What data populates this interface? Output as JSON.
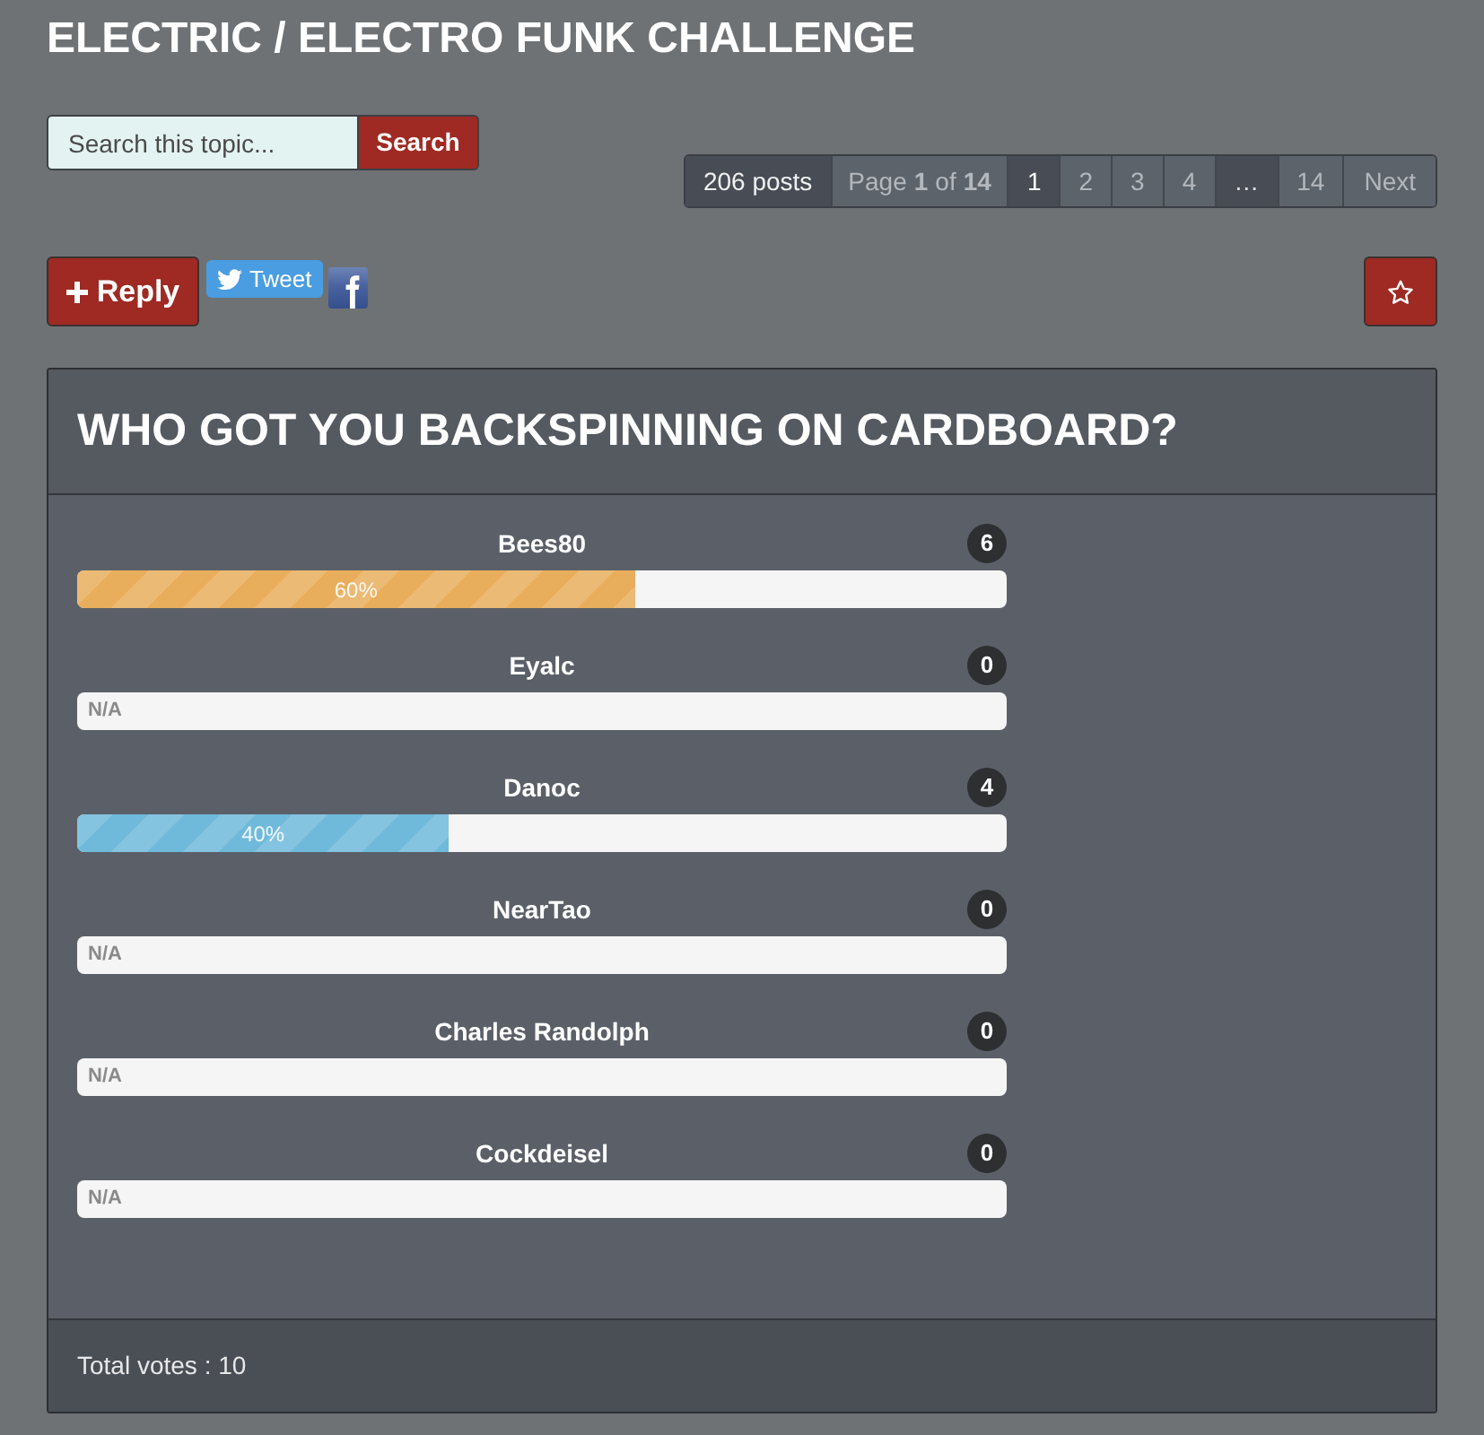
{
  "topic_title": "ELECTRIC / ELECTRO FUNK CHALLENGE",
  "search": {
    "placeholder": "Search this topic...",
    "button": "Search"
  },
  "pagination": {
    "post_count": "206 posts",
    "page_info": "Page **1** of **14**",
    "pages": [
      {
        "label": "1",
        "kind": "page",
        "selected": true
      },
      {
        "label": "2",
        "kind": "page",
        "selected": false
      },
      {
        "label": "3",
        "kind": "page",
        "selected": false
      },
      {
        "label": "4",
        "kind": "page",
        "selected": false
      },
      {
        "label": "…",
        "kind": "ellipsis",
        "selected": false
      },
      {
        "label": "14",
        "kind": "page",
        "selected": false
      }
    ],
    "next": "Next"
  },
  "actions": {
    "reply": "Reply",
    "tweet": "Tweet"
  },
  "poll": {
    "question": "WHO GOT YOU BACKSPINNING ON CARDBOARD?",
    "options": [
      {
        "name": "Bees80",
        "votes": "6",
        "level": 0.6,
        "reading": "60%",
        "color": "#e8ae5c"
      },
      {
        "name": "Eyalc",
        "votes": "0",
        "level": 0,
        "reading": "N/A"
      },
      {
        "name": "Danoc",
        "votes": "4",
        "level": 0.4,
        "reading": "40%",
        "color": "#6fbadb"
      },
      {
        "name": "NearTao",
        "votes": "0",
        "level": 0,
        "reading": "N/A"
      },
      {
        "name": "Charles Randolph",
        "votes": "0",
        "level": 0,
        "reading": "N/A"
      },
      {
        "name": "Cockdeisel",
        "votes": "0",
        "level": 0,
        "reading": "N/A"
      }
    ],
    "total": "Total votes : 10"
  }
}
